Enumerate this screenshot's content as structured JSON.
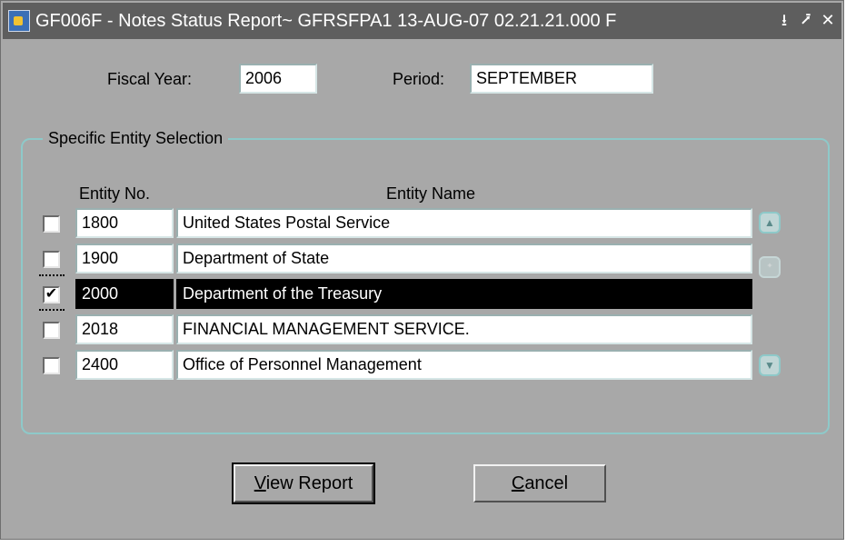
{
  "window": {
    "title": "GF006F - Notes Status Report~ GFRSFPA1  13-AUG-07 02.21.21.000 F",
    "minimize_glyph": "⭳",
    "maximize_glyph": "⭷",
    "close_glyph": "✕"
  },
  "fields": {
    "fiscal_year_label": "Fiscal Year:",
    "fiscal_year_value": "2006",
    "period_label": "Period:",
    "period_value": "SEPTEMBER"
  },
  "group": {
    "title": "Specific Entity Selection",
    "col_entity_no": "Entity No.",
    "col_entity_name": "Entity Name",
    "rows": [
      {
        "checked": false,
        "no": "1800",
        "name": "United States Postal Service"
      },
      {
        "checked": false,
        "no": "1900",
        "name": "Department of State"
      },
      {
        "checked": true,
        "no": "2000",
        "name": "Department of the Treasury"
      },
      {
        "checked": false,
        "no": "2018",
        "name": "FINANCIAL MANAGEMENT SERVICE."
      },
      {
        "checked": false,
        "no": "2400",
        "name": "Office of Personnel Management"
      }
    ],
    "checkmark": "✔"
  },
  "buttons": {
    "view_report_mnemonic": "V",
    "view_report_rest": "iew Report",
    "cancel_mnemonic": "C",
    "cancel_rest": "ancel"
  },
  "icons": {
    "app": "oracle-forms-app-icon",
    "scroll_up": "▲",
    "scroll_mid": "⁺",
    "scroll_down": "▼"
  }
}
